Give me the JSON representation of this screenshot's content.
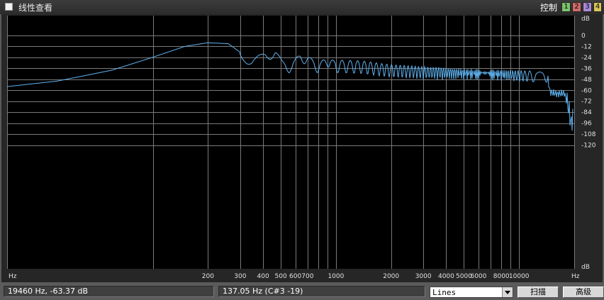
{
  "window": {
    "title": "线性查看"
  },
  "controls": {
    "label": "控制",
    "buttons": [
      {
        "label": "1",
        "color": "#7cc36a"
      },
      {
        "label": "2",
        "color": "#d06a6a"
      },
      {
        "label": "3",
        "color": "#a78ad6"
      },
      {
        "label": "4",
        "color": "#d9c45a"
      }
    ]
  },
  "plot": {
    "line_color": "#5fb3f0",
    "grid_color": "#7a7a7a",
    "x_ticks": [
      {
        "label": "Hz",
        "hz": 16
      },
      {
        "label": "200",
        "hz": 200
      },
      {
        "label": "300",
        "hz": 300
      },
      {
        "label": "400",
        "hz": 400
      },
      {
        "label": "500",
        "hz": 500
      },
      {
        "label": "600",
        "hz": 600
      },
      {
        "label": "700",
        "hz": 700
      },
      {
        "label": "1000",
        "hz": 1000
      },
      {
        "label": "2000",
        "hz": 2000
      },
      {
        "label": "3000",
        "hz": 3000
      },
      {
        "label": "4000",
        "hz": 4000
      },
      {
        "label": "5000",
        "hz": 5000
      },
      {
        "label": "6000",
        "hz": 6000
      },
      {
        "label": "8000",
        "hz": 8000
      },
      {
        "label": "10000",
        "hz": 10000
      },
      {
        "label": "Hz",
        "hz": 20000
      }
    ],
    "x_grid_hz": [
      16,
      100,
      200,
      300,
      400,
      500,
      600,
      700,
      800,
      900,
      1000,
      2000,
      3000,
      4000,
      5000,
      6000,
      7000,
      8000,
      9000,
      10000,
      20000
    ],
    "y_ticks": [
      {
        "label": "dB",
        "db": 7.5
      },
      {
        "label": "0",
        "db": 0
      },
      {
        "label": "-12",
        "db": -12
      },
      {
        "label": "-24",
        "db": -24
      },
      {
        "label": "-36",
        "db": -36
      },
      {
        "label": "-48",
        "db": -48
      },
      {
        "label": "-60",
        "db": -60
      },
      {
        "label": "-72",
        "db": -72
      },
      {
        "label": "-84",
        "db": -84
      },
      {
        "label": "-96",
        "db": -96
      },
      {
        "label": "-108",
        "db": -108
      },
      {
        "label": "-120",
        "db": -120
      },
      {
        "label": "dB",
        "db": -127
      }
    ],
    "spectrum_hz_db": [
      [
        16,
        -56
      ],
      [
        30,
        -50
      ],
      [
        60,
        -38
      ],
      [
        100,
        -24
      ],
      [
        150,
        -12
      ],
      [
        200,
        -8
      ],
      [
        260,
        -9
      ],
      [
        320,
        -22
      ],
      [
        350,
        -29
      ],
      [
        420,
        -20
      ],
      [
        470,
        -18
      ],
      [
        510,
        -30
      ],
      [
        560,
        -34
      ],
      [
        640,
        -24
      ],
      [
        700,
        -24
      ],
      [
        800,
        -34
      ],
      [
        900,
        -27
      ],
      [
        1000,
        -31
      ],
      [
        1400,
        -32
      ],
      [
        2000,
        -36
      ],
      [
        3000,
        -38
      ],
      [
        5000,
        -40
      ],
      [
        8000,
        -41
      ],
      [
        10000,
        -42
      ],
      [
        14500,
        -43
      ],
      [
        15000,
        -62
      ],
      [
        16500,
        -64
      ],
      [
        18000,
        -63
      ],
      [
        19000,
        -80
      ],
      [
        19600,
        -98
      ],
      [
        20000,
        -88
      ]
    ]
  },
  "status": {
    "cursor_readout": "19460 Hz, -63.37 dB",
    "note_readout": "137.05 Hz (C#3 -19)",
    "display_mode": "Lines",
    "scan_button": "扫描",
    "advanced_button": "高级"
  }
}
